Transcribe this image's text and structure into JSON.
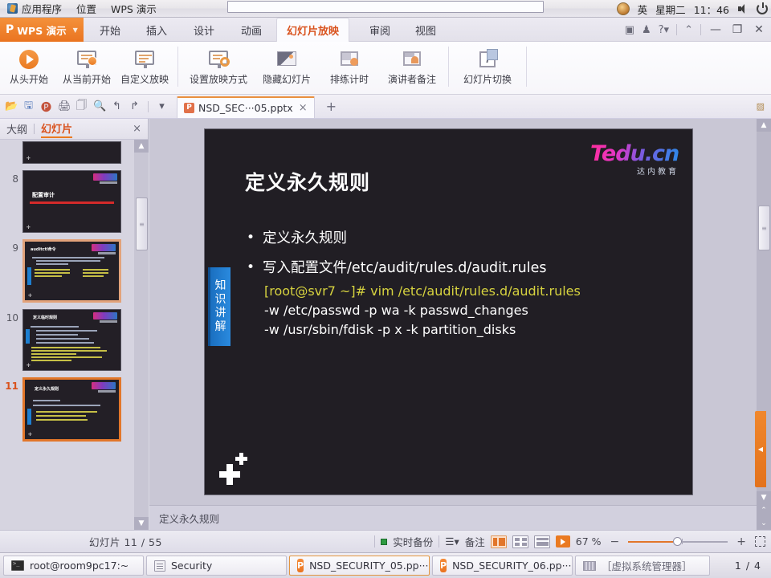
{
  "gnome_panel": {
    "menus": [
      "应用程序",
      "位置",
      "WPS 演示"
    ],
    "input_method": "英",
    "day": "星期二",
    "time": "11：46",
    "icons": [
      "applications-icon",
      "user-avatar",
      "volume-icon",
      "power-icon"
    ]
  },
  "wps": {
    "logo_label": "WPS 演示",
    "ribbon_tabs": [
      {
        "label": "开始",
        "active": false
      },
      {
        "label": "插入",
        "active": false
      },
      {
        "label": "设计",
        "active": false
      },
      {
        "label": "动画",
        "active": false
      },
      {
        "label": "幻灯片放映",
        "active": true
      },
      {
        "label": "审阅",
        "active": false
      },
      {
        "label": "视图",
        "active": false
      }
    ],
    "window_controls": [
      "minimize",
      "restore",
      "close"
    ],
    "ribbon_groups": [
      {
        "buttons": [
          {
            "label": "从头开始",
            "icon": "play-circle-icon"
          },
          {
            "label": "从当前开始",
            "icon": "screen-play-icon"
          },
          {
            "label": "自定义放映",
            "icon": "screen-custom-icon"
          }
        ]
      },
      {
        "buttons": [
          {
            "label": "设置放映方式",
            "icon": "screen-settings-icon"
          },
          {
            "label": "隐藏幻灯片",
            "icon": "hide-slide-icon"
          },
          {
            "label": "排练计时",
            "icon": "rehearse-timing-icon"
          },
          {
            "label": "演讲者备注",
            "icon": "presenter-notes-icon"
          }
        ]
      },
      {
        "buttons": [
          {
            "label": "幻灯片切换",
            "icon": "slide-transition-icon"
          }
        ]
      }
    ],
    "quick_access": [
      "open-icon",
      "save-icon",
      "export-pdf-icon",
      "print-icon",
      "print-preview-icon",
      "find-icon",
      "undo-icon",
      "redo-icon",
      "customize-caret-icon"
    ],
    "doc_tab": {
      "label": "NSD_SEC···05.pptx",
      "icon": "pptx-file-icon"
    },
    "new_tab_label": "+"
  },
  "left_panel": {
    "tabs": [
      {
        "label": "大纲",
        "active": false
      },
      {
        "label": "幻灯片",
        "active": true
      }
    ],
    "close_label": "×",
    "thumbnails": [
      {
        "number": "",
        "title": "",
        "selected": false
      },
      {
        "number": "8",
        "title": "配置审计",
        "selected": false
      },
      {
        "number": "9",
        "title": "auditctl命令",
        "selected": false
      },
      {
        "number": "10",
        "title": "定义临时规则",
        "selected": false
      },
      {
        "number": "11",
        "title": "定义永久规则",
        "selected": true
      }
    ]
  },
  "slide": {
    "logo_text": "Tedu.cn",
    "logo_sub": "达内教育",
    "title": "定义永久规则",
    "bullets": [
      "定义永久规则",
      "写入配置文件/etc/audit/rules.d/audit.rules"
    ],
    "side_tag": "知识讲解",
    "code_lines": [
      {
        "text": "[root@svr7 ~]# vim  /etc/audit/rules.d/audit.rules",
        "highlight": true
      },
      {
        "text": "-w /etc/passwd -p wa -k passwd_changes",
        "highlight": false
      },
      {
        "text": "-w /usr/sbin/fdisk -p x -k partition_disks",
        "highlight": false
      }
    ],
    "background": "#211e24",
    "accent_blue": "#2a8ade",
    "code_accent": "#d6d23f"
  },
  "notes_pane": {
    "text": "定义永久规则"
  },
  "status_bar": {
    "page_label": "幻灯片 11 / 55",
    "backup_label": "实时备份",
    "notes_label": "备注",
    "view_buttons": [
      "normal-view-icon",
      "slide-sorter-icon",
      "reading-view-icon",
      "slideshow-icon"
    ],
    "zoom_label": "67 %",
    "zoom_minus": "−",
    "zoom_plus": "+",
    "fit_icon": "fit-to-window-icon"
  },
  "taskbar": {
    "items": [
      {
        "label": "root@room9pc17:~",
        "icon": "terminal-icon"
      },
      {
        "label": "Security",
        "icon": "document-icon"
      },
      {
        "label": "NSD_SECURITY_05.pp···",
        "icon": "pptx-file-icon"
      },
      {
        "label": "NSD_SECURITY_06.pp···",
        "icon": "pptx-file-icon"
      },
      {
        "label": "［虚拟系统管理器］",
        "icon": "virt-manager-icon"
      }
    ],
    "workspace": "1 / 4"
  }
}
